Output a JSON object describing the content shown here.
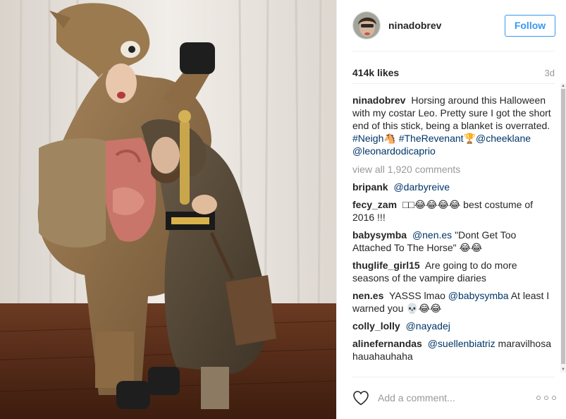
{
  "post": {
    "username": "ninadobrev",
    "follow_label": "Follow",
    "likes": "414k likes",
    "time_ago": "3d",
    "caption": {
      "user": "ninadobrev",
      "text": "Horsing around this Halloween with my costar Leo. Pretty sure I got the short end of this stick, being a blanket is overrated.",
      "tag1": "#Neigh",
      "emoji1": "🐴",
      "tag2": "#TheRevenant",
      "emoji2": "🏆",
      "mention1": "@cheeklane",
      "mention2": "@leonardodicaprio"
    },
    "view_all": "view all 1,920 comments",
    "comments": [
      {
        "user": "bripank",
        "text": "",
        "mention": "@darbyreive",
        "after": ""
      },
      {
        "user": "fecy_zam",
        "text": "",
        "mention": "",
        "after": "□□😂😂😂😂 best costume of 2016 !!!"
      },
      {
        "user": "babysymba",
        "text": "",
        "mention": "@nen.es",
        "after": "\"Dont Get Too Attached To The Horse\" 😂😂"
      },
      {
        "user": "thuglife_girl15",
        "text": "Are going to do more seasons of the vampire diaries",
        "mention": "",
        "after": ""
      },
      {
        "user": "nen.es",
        "text": "YASSS lmao",
        "mention": "@babysymba",
        "after": "At least I warned you 💀😂😂"
      },
      {
        "user": "colly_lolly",
        "text": "",
        "mention": "@nayadej",
        "after": ""
      },
      {
        "user": "alinefernandas",
        "text": "",
        "mention": "@suellenbiatriz",
        "after": "maravilhosa hauahauhaha"
      }
    ],
    "comment_placeholder": "Add a comment...",
    "icons": {
      "like": "heart-icon",
      "more": "more-options-icon"
    },
    "colors": {
      "accent": "#3897f0",
      "link": "#003569",
      "muted": "#999999"
    }
  }
}
